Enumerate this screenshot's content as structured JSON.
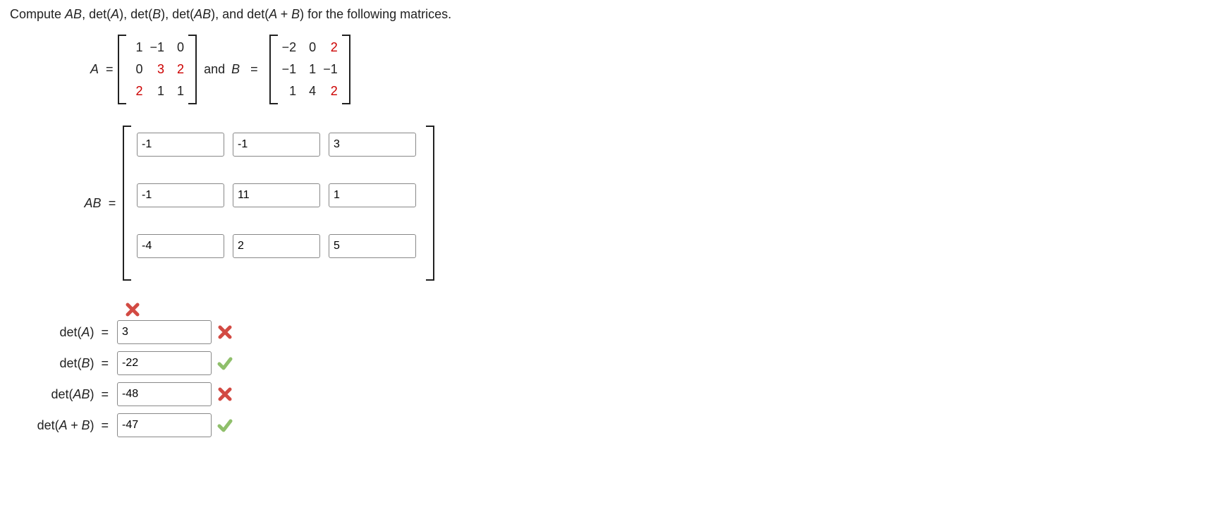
{
  "prompt": {
    "text_pre": "Compute ",
    "i1": "AB",
    "s1": ", det(",
    "i2": "A",
    "s2": "), det(",
    "i3": "B",
    "s3": "), det(",
    "i4": "AB",
    "s4": "), and det(",
    "i5": "A + B",
    "s5": ") for the following matrices."
  },
  "matrices": {
    "A_label": "A",
    "B_label": "B",
    "and_text": "and",
    "A": [
      [
        "1",
        "−1",
        "0"
      ],
      [
        "0",
        "3",
        "2"
      ],
      [
        "2",
        "1",
        "1"
      ]
    ],
    "A_red": [
      [
        false,
        false,
        false
      ],
      [
        false,
        true,
        true
      ],
      [
        true,
        false,
        false
      ]
    ],
    "B": [
      [
        "−2",
        "0",
        "2"
      ],
      [
        "−1",
        "1",
        "−1"
      ],
      [
        "1",
        "4",
        "2"
      ]
    ],
    "B_red": [
      [
        false,
        false,
        true
      ],
      [
        false,
        false,
        false
      ],
      [
        false,
        false,
        true
      ]
    ]
  },
  "AB": {
    "label": "AB",
    "values": [
      [
        "-1",
        "-1",
        "3"
      ],
      [
        "-1",
        "11",
        "1"
      ],
      [
        "-4",
        "2",
        "5"
      ]
    ]
  },
  "marks": {
    "cross_above": "incorrect"
  },
  "det": [
    {
      "label_pre": "det(",
      "var": "A",
      "label_post": ")",
      "value": "3",
      "mark": "incorrect"
    },
    {
      "label_pre": "det(",
      "var": "B",
      "label_post": ")",
      "value": "-22",
      "mark": "correct"
    },
    {
      "label_pre": "det(",
      "var": "AB",
      "label_post": ")",
      "value": "-48",
      "mark": "incorrect"
    },
    {
      "label_pre": "det(",
      "var": "A + B",
      "label_post": ")",
      "value": "-47",
      "mark": "correct"
    }
  ]
}
